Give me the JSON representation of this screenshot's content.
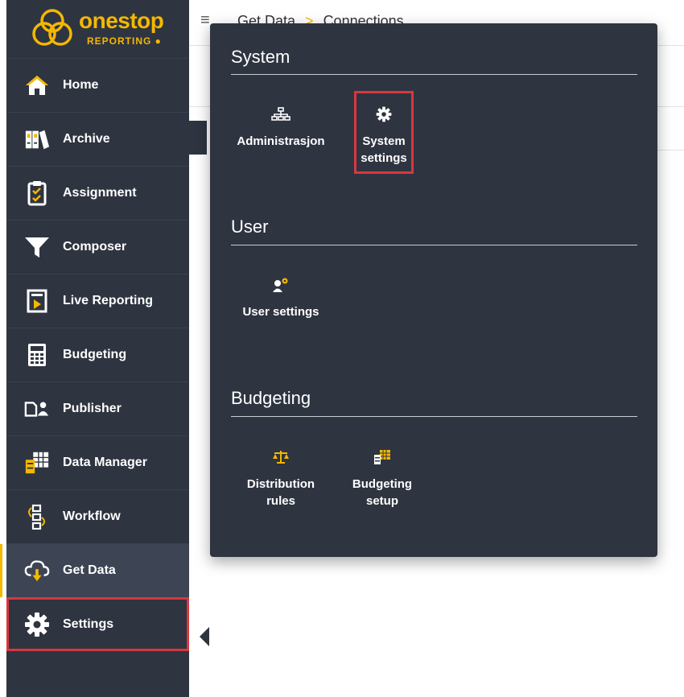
{
  "brand": {
    "name": "onestop",
    "sub": "REPORTING",
    "color": "#f5b800"
  },
  "topbar": {
    "breadcrumb_root": "Get Data",
    "breadcrumb_sep": ">",
    "breadcrumb_current": "Connections"
  },
  "sidebar": {
    "items": [
      {
        "label": "Home",
        "icon": "home-icon"
      },
      {
        "label": "Archive",
        "icon": "archive-binders-icon"
      },
      {
        "label": "Assignment",
        "icon": "clipboard-check-icon"
      },
      {
        "label": "Composer",
        "icon": "funnel-icon"
      },
      {
        "label": "Live Reporting",
        "icon": "play-document-icon"
      },
      {
        "label": "Budgeting",
        "icon": "calculator-icon"
      },
      {
        "label": "Publisher",
        "icon": "publisher-icon"
      },
      {
        "label": "Data Manager",
        "icon": "data-grid-icon"
      },
      {
        "label": "Workflow",
        "icon": "workflow-icon"
      },
      {
        "label": "Get Data",
        "icon": "cloud-download-icon",
        "active": true
      },
      {
        "label": "Settings",
        "icon": "gear-icon",
        "highlighted": true
      }
    ]
  },
  "flyout": {
    "sections": [
      {
        "title": "System",
        "tiles": [
          {
            "label": "Administrasjon",
            "icon": "org-chart-icon"
          },
          {
            "label": "System settings",
            "icon": "gear-icon",
            "highlighted": true
          }
        ]
      },
      {
        "title": "User",
        "tiles": [
          {
            "label": "User settings",
            "icon": "user-settings-icon"
          }
        ]
      },
      {
        "title": "Budgeting",
        "tiles": [
          {
            "label": "Distribution rules",
            "icon": "scales-icon"
          },
          {
            "label": "Budgeting setup",
            "icon": "budget-setup-icon"
          }
        ]
      }
    ]
  },
  "colors": {
    "sidebar_bg": "#2e3440",
    "accent": "#f5b800",
    "highlight_border": "#d8373f"
  }
}
